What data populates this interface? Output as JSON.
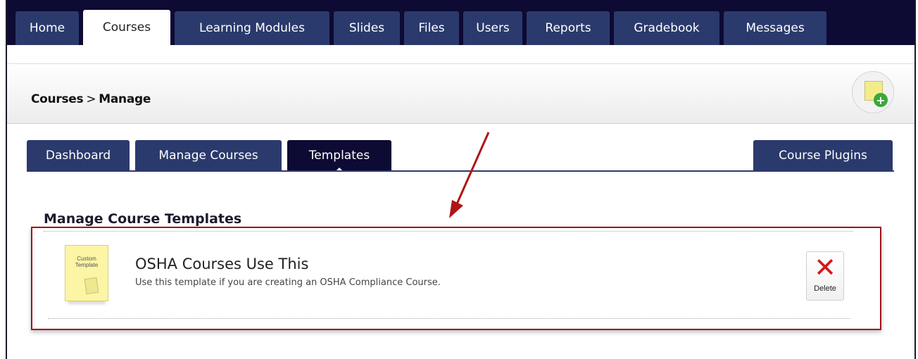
{
  "nav": {
    "tabs": [
      "Home",
      "Courses",
      "Learning Modules",
      "Slides",
      "Files",
      "Users",
      "Reports",
      "Gradebook",
      "Messages"
    ],
    "active": "Courses"
  },
  "header": {
    "breadcrumb_root": "Courses",
    "breadcrumb_sep": ">",
    "breadcrumb_current": "Manage"
  },
  "subnav": {
    "tabs": [
      "Dashboard",
      "Manage Courses",
      "Templates"
    ],
    "active": "Templates",
    "right_tab": "Course Plugins"
  },
  "main": {
    "section_title": "Manage Course Templates",
    "templates": [
      {
        "thumb_label": "Custom Template",
        "title": "OSHA Courses Use This",
        "description": "Use this template if you are creating an OSHA Compliance Course.",
        "delete_label": "Delete"
      }
    ]
  },
  "colors": {
    "nav_bg": "#0d0a33",
    "tab_bg": "#2b3a6c",
    "highlight_border": "#a3121a",
    "delete_icon": "#d21a1a"
  },
  "icons": {
    "add": "add-course-plus-icon",
    "delete": "delete-x-icon",
    "thumbnail": "template-thumbnail-icon"
  }
}
